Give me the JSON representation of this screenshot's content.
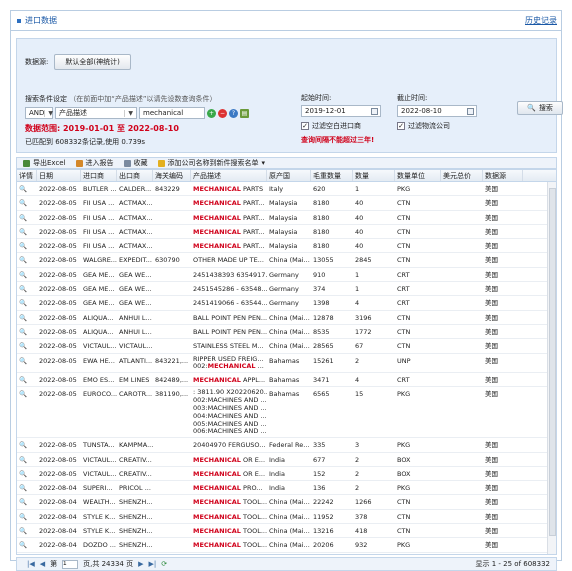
{
  "header": {
    "title": "进口数据",
    "history_link": "历史记录"
  },
  "filters": {
    "source_label": "数据源:",
    "source_button": "默认全部(神统计)",
    "condition_label": "搜索条件设定",
    "condition_hint": "（在前面中加“产品描述”以请先设数查询条件）",
    "logic_select": "AND",
    "field_select": "产品描述",
    "keyword_value": "mechanical",
    "data_range": "数据范围: 2019-01-01 至 2022-08-10",
    "matched": "已匹配到 608332条记录,使用 0.739s",
    "start_label": "起始时间:",
    "start_date": "2019-12-01",
    "end_label": "截止时间:",
    "end_date": "2022-08-10",
    "chk_own": "过滤空白进口商",
    "chk_logistics": "过滤物流公司",
    "warning": "查询间隔不能超过三年!",
    "search_button": "搜索"
  },
  "toolbar": {
    "export": "导出Excel",
    "report": "进入报告",
    "collect": "收藏",
    "add_company": "添加公司名称到新件搜索名单"
  },
  "table": {
    "columns": [
      "详情",
      "日期",
      "进口商",
      "出口商",
      "海关编码",
      "产品描述",
      "原产国",
      "毛重数量",
      "数量",
      "数量单位",
      "美元总价",
      "数据源"
    ],
    "rows": [
      [
        "2022-08-05",
        "BUTLER ...",
        "CALDER...",
        "843229",
        "MECHANICAL PARTS",
        "Italy",
        "620",
        "1",
        "PKG",
        "",
        "美国"
      ],
      [
        "2022-08-05",
        "FII USA ...",
        "ACTMAX...",
        "",
        "MECHANICAL PART...",
        "Malaysia",
        "8180",
        "40",
        "CTN",
        "",
        "美国"
      ],
      [
        "2022-08-05",
        "FII USA ...",
        "ACTMAX...",
        "",
        "MECHANICAL PART...",
        "Malaysia",
        "8180",
        "40",
        "CTN",
        "",
        "美国"
      ],
      [
        "2022-08-05",
        "FII USA ...",
        "ACTMAX...",
        "",
        "MECHANICAL PART...",
        "Malaysia",
        "8180",
        "40",
        "CTN",
        "",
        "美国"
      ],
      [
        "2022-08-05",
        "FII USA ...",
        "ACTMAX...",
        "",
        "MECHANICAL PART...",
        "Malaysia",
        "8180",
        "40",
        "CTN",
        "",
        "美国"
      ],
      [
        "2022-08-05",
        "WALGRE...",
        "EXPEDIT...",
        "630790",
        "OTHER MADE UP TE...",
        "China (Mai...",
        "13055",
        "2845",
        "CTN",
        "",
        "美国"
      ],
      [
        "2022-08-05",
        "GEA ME...",
        "GEA WE...",
        "",
        "2451438393 6354917...",
        "Germany",
        "910",
        "1",
        "CRT",
        "",
        "美国"
      ],
      [
        "2022-08-05",
        "GEA ME...",
        "GEA WE...",
        "",
        "2451545286 - 63548...",
        "Germany",
        "374",
        "1",
        "CRT",
        "",
        "美国"
      ],
      [
        "2022-08-05",
        "GEA ME...",
        "GEA WE...",
        "",
        "2451419066 - 63544...",
        "Germany",
        "1398",
        "4",
        "CRT",
        "",
        "美国"
      ],
      [
        "2022-08-05",
        "ALIQUA...",
        "ANHUI L...",
        "",
        "BALL POINT PEN PEN...",
        "China (Mai...",
        "12878",
        "3196",
        "CTN",
        "",
        "美国"
      ],
      [
        "2022-08-05",
        "ALIQUA...",
        "ANHUI L...",
        "",
        "BALL POINT PEN PEN...",
        "China (Mai...",
        "8535",
        "1772",
        "CTN",
        "",
        "美国"
      ],
      [
        "2022-08-05",
        "VICTAUL...",
        "VICTAUL...",
        "",
        "STAINLESS STEEL M...",
        "China (Mai...",
        "28565",
        "67",
        "CTN",
        "",
        "美国"
      ],
      [
        "2022-08-05",
        "EWA HE...",
        "ATLANTI...",
        "843221,...",
        "RIPPER USED FREIG...\n002:MECHANICAL ...",
        "Bahamas",
        "15261",
        "2",
        "UNP",
        "",
        "美国"
      ],
      [
        "2022-08-05",
        "EMO ES...",
        "EM LINES",
        "842489,...",
        "MECHANICAL APPL...",
        "Bahamas",
        "3471",
        "4",
        "CRT",
        "",
        "美国"
      ],
      [
        "2022-08-05",
        "EUROCO...",
        "CAROTR...",
        "381190,...",
        ": 3811.90 X20220620...\n002:MACHINES AND ...\n003:MACHINES AND ...\n004:MACHINES AND ...\n005:MACHINES AND ...\n006:MACHINES AND ...",
        "Bahamas",
        "6565",
        "15",
        "PKG",
        "",
        "美国"
      ],
      [
        "2022-08-05",
        "TUNSTA...",
        "KAMPMA...",
        "",
        "20404970 FERGUSO...",
        "Federal Re...",
        "335",
        "3",
        "PKG",
        "",
        "美国"
      ],
      [
        "2022-08-05",
        "VICTAUL...",
        "CREATIV...",
        "",
        "MECHANICAL OR E...",
        "India",
        "677",
        "2",
        "BOX",
        "",
        "美国"
      ],
      [
        "2022-08-05",
        "VICTAUL...",
        "CREATIV...",
        "",
        "MECHANICAL OR E...",
        "India",
        "152",
        "2",
        "BOX",
        "",
        "美国"
      ],
      [
        "2022-08-04",
        "SUPERI...",
        "PRICOL ...",
        "",
        "MECHANICAL PRO...",
        "India",
        "136",
        "2",
        "PKG",
        "",
        "美国"
      ],
      [
        "2022-08-04",
        "WEALTH...",
        "SHENZH...",
        "",
        "MECHANICAL TOOL...",
        "China (Mai...",
        "22242",
        "1266",
        "CTN",
        "",
        "美国"
      ],
      [
        "2022-08-04",
        "STYLE K...",
        "SHENZH...",
        "",
        "MECHANICAL TOOL...",
        "China (Mai...",
        "11952",
        "378",
        "CTN",
        "",
        "美国"
      ],
      [
        "2022-08-04",
        "STYLE K...",
        "SHENZH...",
        "",
        "MECHANICAL TOOL...",
        "China (Mai...",
        "13216",
        "418",
        "CTN",
        "",
        "美国"
      ],
      [
        "2022-08-04",
        "DOZDO ...",
        "SHENZH...",
        "",
        "MECHANICAL TOOL...",
        "China (Mai...",
        "20206",
        "932",
        "PKG",
        "",
        "美国"
      ]
    ]
  },
  "pager": {
    "page_label": "第",
    "page_value": "1",
    "total_pages": "页,共 24334 页",
    "summary": "显示 1 - 25 of 608332"
  }
}
